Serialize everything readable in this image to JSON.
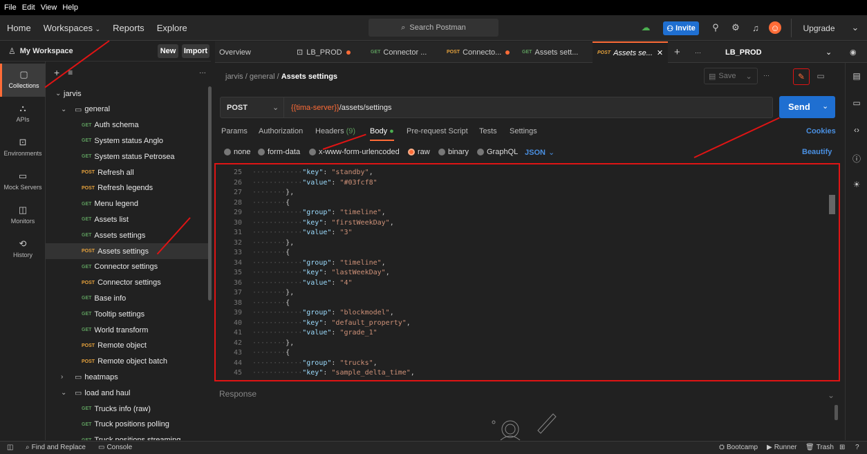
{
  "menubar": [
    "File",
    "Edit",
    "View",
    "Help"
  ],
  "topnav": {
    "home": "Home",
    "workspaces": "Workspaces",
    "reports": "Reports",
    "explore": "Explore",
    "search_placeholder": "Search Postman",
    "invite": "Invite",
    "upgrade": "Upgrade"
  },
  "workspace": {
    "name": "My Workspace",
    "new_label": "New",
    "import_label": "Import"
  },
  "rail": [
    {
      "label": "Collections",
      "icon": "collections-icon"
    },
    {
      "label": "APIs",
      "icon": "apis-icon"
    },
    {
      "label": "Environments",
      "icon": "environments-icon"
    },
    {
      "label": "Mock Servers",
      "icon": "mock-servers-icon"
    },
    {
      "label": "Monitors",
      "icon": "monitors-icon"
    },
    {
      "label": "History",
      "icon": "history-icon"
    }
  ],
  "tree": [
    {
      "type": "collection",
      "label": "jarvis"
    },
    {
      "type": "folder",
      "label": "general",
      "open": true
    },
    {
      "type": "req",
      "method": "GET",
      "label": "Auth schema"
    },
    {
      "type": "req",
      "method": "GET",
      "label": "System status Anglo"
    },
    {
      "type": "req",
      "method": "GET",
      "label": "System status Petrosea"
    },
    {
      "type": "req",
      "method": "POST",
      "label": "Refresh all"
    },
    {
      "type": "req",
      "method": "POST",
      "label": "Refresh legends"
    },
    {
      "type": "req",
      "method": "GET",
      "label": "Menu legend"
    },
    {
      "type": "req",
      "method": "GET",
      "label": "Assets list"
    },
    {
      "type": "req",
      "method": "GET",
      "label": "Assets settings"
    },
    {
      "type": "req",
      "method": "POST",
      "label": "Assets settings",
      "selected": true
    },
    {
      "type": "req",
      "method": "GET",
      "label": "Connector settings"
    },
    {
      "type": "req",
      "method": "POST",
      "label": "Connector settings"
    },
    {
      "type": "req",
      "method": "GET",
      "label": "Base info"
    },
    {
      "type": "req",
      "method": "GET",
      "label": "Tooltip settings"
    },
    {
      "type": "req",
      "method": "GET",
      "label": "World transform"
    },
    {
      "type": "req",
      "method": "POST",
      "label": "Remote object"
    },
    {
      "type": "req",
      "method": "POST",
      "label": "Remote object batch"
    },
    {
      "type": "folder",
      "label": "heatmaps",
      "open": false
    },
    {
      "type": "folder",
      "label": "load and haul",
      "open": true
    },
    {
      "type": "req",
      "method": "GET",
      "label": "Trucks info (raw)"
    },
    {
      "type": "req",
      "method": "GET",
      "label": "Truck positions polling"
    },
    {
      "type": "req",
      "method": "GET",
      "label": "Truck positions streaming"
    }
  ],
  "tabs": [
    {
      "label": "Overview"
    },
    {
      "label": "LB_PROD",
      "dot": true
    },
    {
      "method": "GET",
      "label": "Connector ..."
    },
    {
      "method": "POST",
      "label": "Connecto...",
      "dot": true
    },
    {
      "method": "GET",
      "label": "Assets sett..."
    },
    {
      "method": "POST",
      "label": "Assets se...",
      "active": true
    }
  ],
  "environment": "LB_PROD",
  "breadcrumb": {
    "p1": "jarvis",
    "p2": "general",
    "current": "Assets settings"
  },
  "save_label": "Save",
  "request": {
    "method": "POST",
    "url_var": "{{tima-server}}",
    "url_path": "/assets/settings",
    "send": "Send"
  },
  "req_tabs": {
    "params": "Params",
    "authorization": "Authorization",
    "headers": "Headers",
    "headers_count": "(9)",
    "body": "Body",
    "prerequest": "Pre-request Script",
    "tests": "Tests",
    "settings": "Settings",
    "cookies": "Cookies"
  },
  "body_types": {
    "none": "none",
    "form_data": "form-data",
    "urlencoded": "x-www-form-urlencoded",
    "raw": "raw",
    "binary": "binary",
    "graphql": "GraphQL",
    "format": "JSON",
    "beautify": "Beautify"
  },
  "code_lines": [
    {
      "n": "25",
      "pre": "············",
      "key": "\"key\"",
      "sep": ": ",
      "val": "\"standby\"",
      "post": ","
    },
    {
      "n": "26",
      "pre": "············",
      "key": "\"value\"",
      "sep": ": ",
      "val": "\"#03fcf8\"",
      "post": ""
    },
    {
      "n": "27",
      "pre": "········",
      "key": "",
      "sep": "",
      "val": "",
      "post": "},"
    },
    {
      "n": "28",
      "pre": "········",
      "key": "",
      "sep": "",
      "val": "",
      "post": "{"
    },
    {
      "n": "29",
      "pre": "············",
      "key": "\"group\"",
      "sep": ": ",
      "val": "\"timeline\"",
      "post": ","
    },
    {
      "n": "30",
      "pre": "············",
      "key": "\"key\"",
      "sep": ": ",
      "val": "\"firstWeekDay\"",
      "post": ","
    },
    {
      "n": "31",
      "pre": "············",
      "key": "\"value\"",
      "sep": ": ",
      "val": "\"3\"",
      "post": ""
    },
    {
      "n": "32",
      "pre": "········",
      "key": "",
      "sep": "",
      "val": "",
      "post": "},"
    },
    {
      "n": "33",
      "pre": "········",
      "key": "",
      "sep": "",
      "val": "",
      "post": "{"
    },
    {
      "n": "34",
      "pre": "············",
      "key": "\"group\"",
      "sep": ": ",
      "val": "\"timeline\"",
      "post": ","
    },
    {
      "n": "35",
      "pre": "············",
      "key": "\"key\"",
      "sep": ": ",
      "val": "\"lastWeekDay\"",
      "post": ","
    },
    {
      "n": "36",
      "pre": "············",
      "key": "\"value\"",
      "sep": ": ",
      "val": "\"4\"",
      "post": ""
    },
    {
      "n": "37",
      "pre": "········",
      "key": "",
      "sep": "",
      "val": "",
      "post": "},"
    },
    {
      "n": "38",
      "pre": "········",
      "key": "",
      "sep": "",
      "val": "",
      "post": "{"
    },
    {
      "n": "39",
      "pre": "············",
      "key": "\"group\"",
      "sep": ": ",
      "val": "\"blockmodel\"",
      "post": ","
    },
    {
      "n": "40",
      "pre": "············",
      "key": "\"key\"",
      "sep": ": ",
      "val": "\"default_property\"",
      "post": ","
    },
    {
      "n": "41",
      "pre": "············",
      "key": "\"value\"",
      "sep": ": ",
      "val": "\"grade_1\"",
      "post": ""
    },
    {
      "n": "42",
      "pre": "········",
      "key": "",
      "sep": "",
      "val": "",
      "post": "},"
    },
    {
      "n": "43",
      "pre": "········",
      "key": "",
      "sep": "",
      "val": "",
      "post": "{"
    },
    {
      "n": "44",
      "pre": "············",
      "key": "\"group\"",
      "sep": ": ",
      "val": "\"trucks\"",
      "post": ","
    },
    {
      "n": "45",
      "pre": "············",
      "key": "\"key\"",
      "sep": ": ",
      "val": "\"sample_delta_time\"",
      "post": ","
    }
  ],
  "response_label": "Response",
  "statusbar": {
    "find_replace": "Find and Replace",
    "console": "Console",
    "bootcamp": "Bootcamp",
    "runner": "Runner",
    "trash": "Trash"
  },
  "colors": {
    "accent": "#ff6c37",
    "send_blue": "#1f6fd1",
    "annotation_red": "#e01414",
    "get": "#5d9c5d",
    "post": "#e6a23c"
  }
}
